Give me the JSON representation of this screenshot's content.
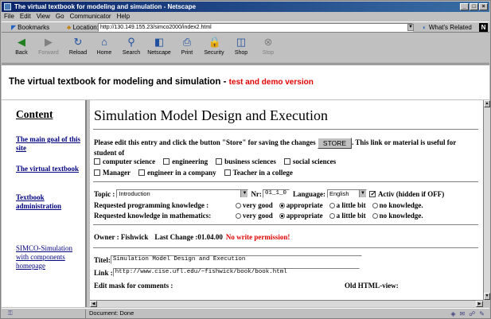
{
  "window": {
    "title": "The virtual textbook for modeling and simulation - Netscape"
  },
  "menu": [
    "File",
    "Edit",
    "View",
    "Go",
    "Communicator",
    "Help"
  ],
  "locationbar": {
    "bookmarks": "Bookmarks",
    "location_label": "Location:",
    "url": "http://130.149.155.23/simco2000/index2.html",
    "whats_related": "What's Related"
  },
  "toolbar": {
    "back": "Back",
    "forward": "Forward",
    "reload": "Reload",
    "home": "Home",
    "search": "Search",
    "netscape": "Netscape",
    "print": "Print",
    "security": "Security",
    "shop": "Shop",
    "stop": "Stop"
  },
  "banner": {
    "title": "The virtual textbook for modeling and simulation",
    "sep": " - ",
    "subtitle": "test and demo version"
  },
  "sidebar": {
    "title": "Content",
    "links": [
      "The main goal of this site",
      "The virtual textbook",
      "Textbook administration",
      "SIMCO-Simulation with components homepage"
    ]
  },
  "main": {
    "heading": "Simulation Model Design and Execution",
    "instr_before": "Please edit this entry and click the button \"Store\" for saving the changes",
    "store_label": "STORE",
    "instr_after": ". This link or material is useful for student of",
    "audiences": [
      "computer science",
      "engineering",
      "business sciences",
      "social sciences",
      "Manager",
      "engineer in a company",
      "Teacher in a college"
    ],
    "topic_label": "Topic :",
    "topic_value": "Introduction",
    "nr_label": "Nr:",
    "nr_value": "01_1_0",
    "language_label": "Language:",
    "language_value": "English",
    "active_label": "Activ (hidden if OFF)",
    "prog_label": "Requested programming knowledge :",
    "math_label": "Requested knowledge in mathematics:",
    "levels": [
      "very good",
      "appropriate",
      "a little bit",
      "no knowledge."
    ],
    "owner_label": "Owner :",
    "owner_value": "Fishwick",
    "change_label": "Last Change :",
    "change_value": "01.04.00",
    "nowrite": "No write permission!",
    "titel_label": "Titel:",
    "titel_value": "Simulation Model Design and Execution",
    "link_label": "Link :",
    "link_value": "http://www.cise.ufl.edu/~fishwick/book/book.html",
    "edit_mask": "Edit mask for comments :",
    "old_html": "Old HTML-view:"
  },
  "status": {
    "text": "Document: Done"
  }
}
